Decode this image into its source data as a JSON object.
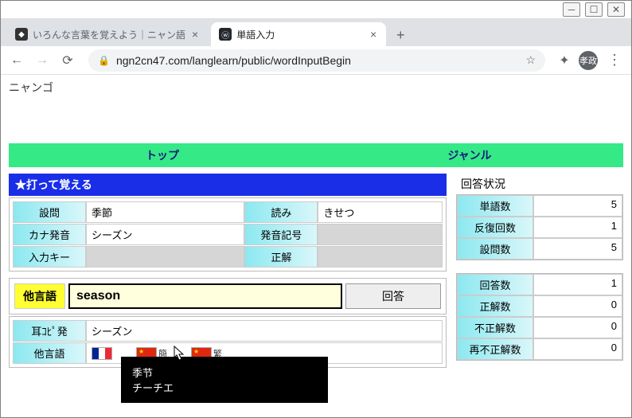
{
  "window": {
    "tabs": [
      {
        "title": "いろんな言葉を覚えよう｜ニャン語",
        "active": false
      },
      {
        "title": "単語入力",
        "active": true
      }
    ],
    "url": "ngn2cn47.com/langlearn/public/wordInputBegin",
    "profile_initials": "孝政"
  },
  "page": {
    "title": "ニャンゴ",
    "topnav": [
      "トップ",
      "ジャンル"
    ],
    "section_header": "★打って覚える",
    "question": {
      "rows": [
        {
          "label1": "設問",
          "value1": "季節",
          "label2": "読み",
          "value2": "きせつ"
        },
        {
          "label1": "カナ発音",
          "value1": "シーズン",
          "label2": "発音記号",
          "value2": ""
        },
        {
          "label1": "入力キー",
          "value1": "",
          "label2": "正解",
          "value2": ""
        }
      ]
    },
    "answer": {
      "tag": "他言語",
      "input_value": "season",
      "button": "回答"
    },
    "extra": {
      "rows": [
        {
          "label": "耳ｺﾋﾟ発",
          "value": "シーズン",
          "type": "text"
        },
        {
          "label": "他言語",
          "type": "flags"
        }
      ],
      "flag_suffixes": {
        "cn_simp": "簡",
        "cn_trad": "繁"
      }
    },
    "tooltip": {
      "line1": "季节",
      "line2": "チーチエ"
    },
    "stats_header": "回答状況",
    "stats1": [
      {
        "label": "単語数",
        "value": "5"
      },
      {
        "label": "反復回数",
        "value": "1"
      },
      {
        "label": "設問数",
        "value": "5"
      }
    ],
    "stats2": [
      {
        "label": "回答数",
        "value": "1"
      },
      {
        "label": "正解数",
        "value": "0"
      },
      {
        "label": "不正解数",
        "value": "0"
      },
      {
        "label": "再不正解数",
        "value": "0"
      }
    ]
  }
}
